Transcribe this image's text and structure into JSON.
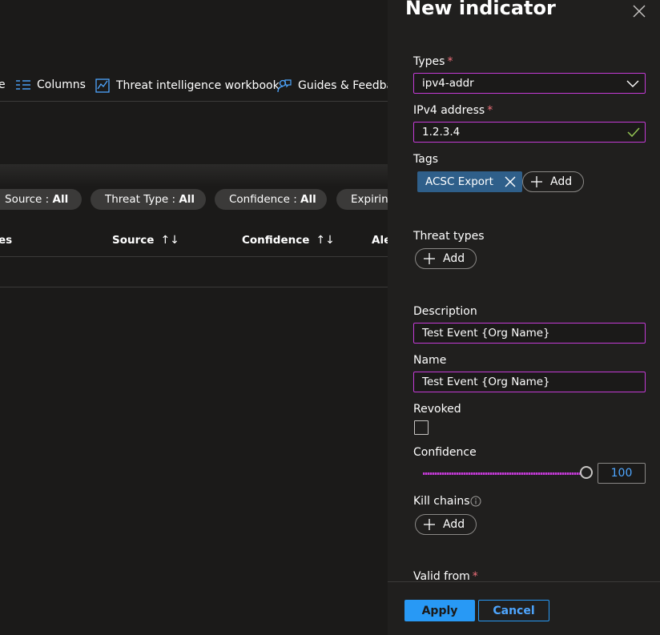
{
  "toolbar": {
    "prev_fragment": "e",
    "columns_label": "Columns",
    "workbook_label": "Threat intelligence workbook",
    "guides_label": "Guides & Feedba"
  },
  "filters": {
    "source": {
      "name": "Source : ",
      "value": "All"
    },
    "threat_type": {
      "name": "Threat Type : ",
      "value": "All"
    },
    "confidence": {
      "name": "Confidence : ",
      "value": "All"
    },
    "expiring": {
      "name": "Expiring"
    }
  },
  "table": {
    "headers": [
      "es",
      "Source",
      "Confidence",
      "Ale"
    ],
    "sort_glyph": "↑↓"
  },
  "panel": {
    "title": "New indicator",
    "types": {
      "label": "Types",
      "value": "ipv4-addr"
    },
    "ipv4": {
      "label": "IPv4 address",
      "value": "1.2.3.4"
    },
    "tags": {
      "label": "Tags",
      "items": [
        "ACSC Export"
      ],
      "add_label": "Add"
    },
    "threat_types": {
      "label": "Threat types",
      "add_label": "Add"
    },
    "description": {
      "label": "Description",
      "value": "Test Event {Org Name}"
    },
    "name": {
      "label": "Name",
      "value": "Test Event {Org Name}"
    },
    "revoked": {
      "label": "Revoked",
      "checked": false
    },
    "confidence": {
      "label": "Confidence",
      "value": "100"
    },
    "kill_chains": {
      "label": "Kill chains",
      "add_label": "Add"
    },
    "valid_from": {
      "label": "Valid from"
    },
    "required_marker": "*",
    "apply_label": "Apply",
    "cancel_label": "Cancel"
  },
  "colors": {
    "accent": "#2899f5",
    "field_border": "#c43bd6",
    "required": "#f1707b",
    "tag_bg": "#2f5f8a",
    "success_check": "#92c353"
  }
}
